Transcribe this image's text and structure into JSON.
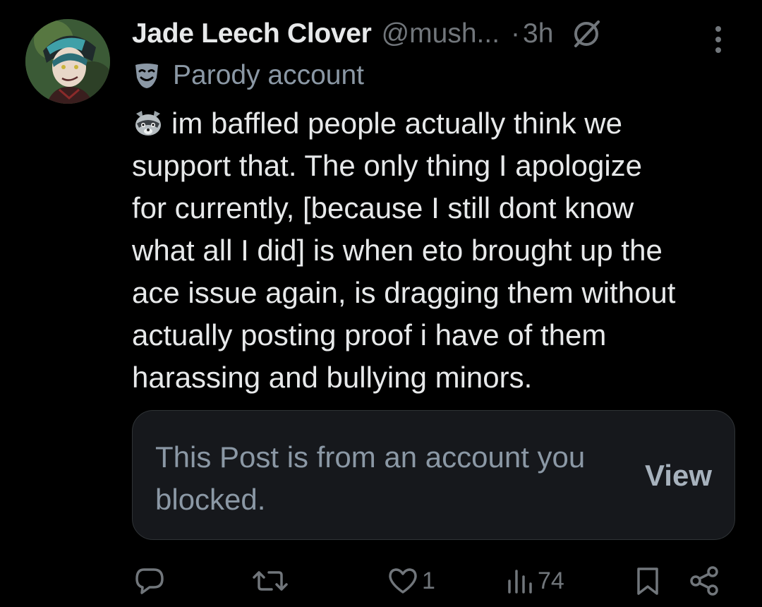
{
  "post": {
    "display_name": "Jade Leech Clover",
    "handle": "@mush...",
    "dot": "·",
    "time": "3h",
    "label": "Parody account",
    "text_line_1": "im baffled people actually think we",
    "text_rest": "support that. The only thing I apologize\nfor currently, [because I still dont know\nwhat all I did] is when eto brought up the\nace issue again, is dragging them without\nactually posting proof i have of them\nharassing and bullying minors."
  },
  "blocked_card": {
    "message": "This Post is from an account you blocked.",
    "view_label": "View"
  },
  "actions": {
    "likes_count": "1",
    "views_count": "74"
  },
  "icons": {
    "avatar": "avatar-image",
    "label": "no-symbol-icon",
    "more": "more-vertical-icon",
    "parody": "theater-mask-icon",
    "emoji": "raccoon-emoji",
    "reply": "reply-icon",
    "repost": "repost-icon",
    "like": "heart-icon",
    "views": "views-icon",
    "bookmark": "bookmark-icon",
    "share": "share-icon"
  },
  "colors": {
    "background": "#000000",
    "primary_text": "#e7e9ea",
    "secondary_text": "#71767b",
    "card_background": "#16181c",
    "card_border": "#2f3336"
  }
}
